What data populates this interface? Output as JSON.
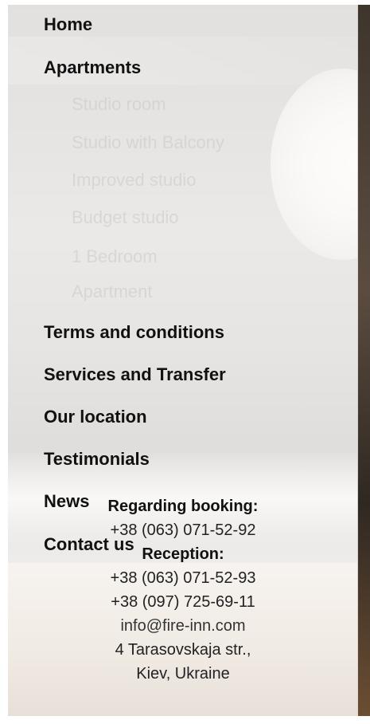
{
  "menu": {
    "home": "Home",
    "apartments": "Apartments",
    "sub": [
      "Studio room",
      "Studio with Balcony",
      "Improved studio",
      "Budget studio",
      "1 Bedroom",
      "Apartment"
    ],
    "terms": "Terms and conditions",
    "services": "Services and Transfer",
    "location": "Our location",
    "testimonials": "Testimonials",
    "news": "News",
    "contact": "Contact us"
  },
  "contact_info": {
    "booking_heading": "Regarding booking:",
    "booking_phone": "+38 (063) 071-52-92",
    "reception_heading": "Reception:",
    "reception_phone_1": "+38 (063) 071-52-93",
    "reception_phone_2": "+38 (097) 725-69-11",
    "email": "info@fire-inn.com",
    "address_line_1": "4 Tarasovskaja str.,",
    "address_line_2": "Kiev, Ukraine"
  }
}
